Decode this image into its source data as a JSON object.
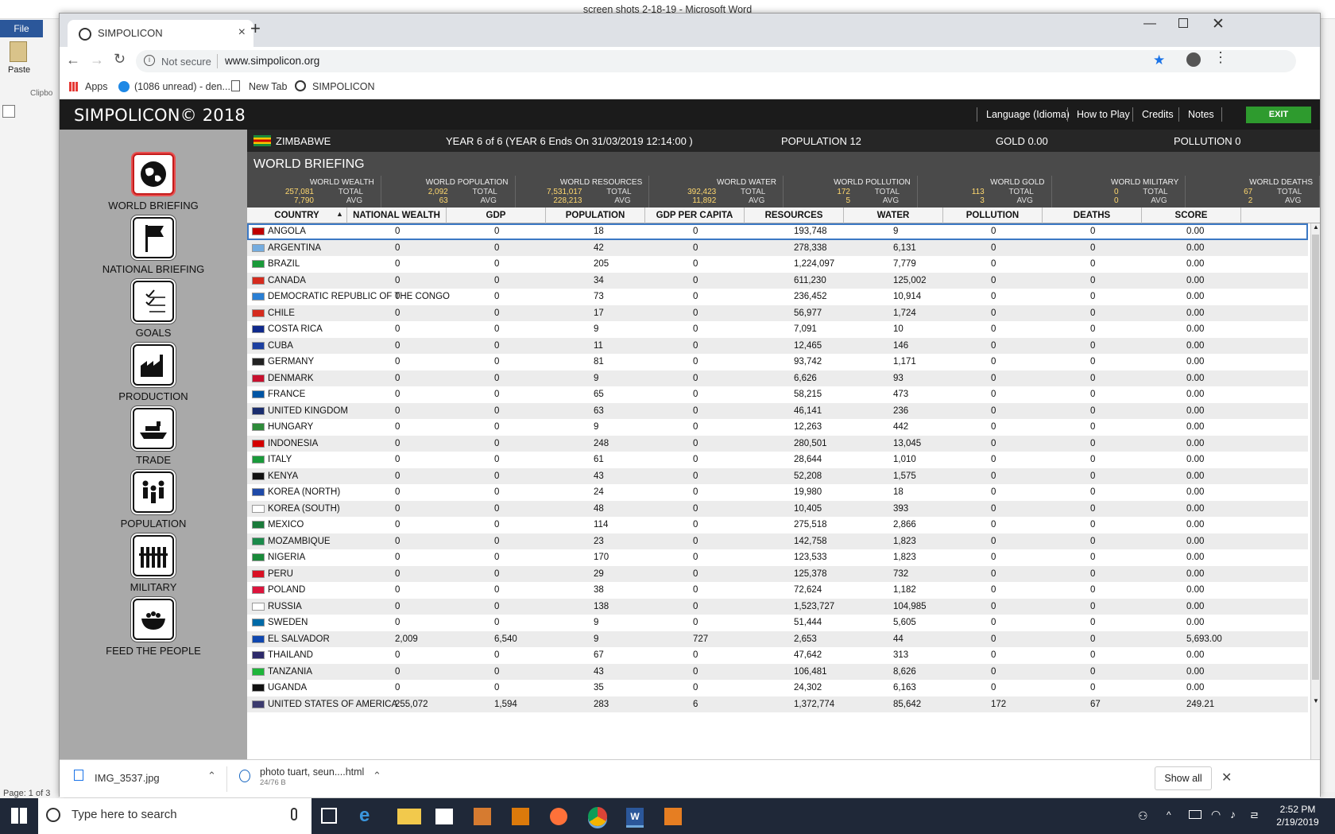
{
  "word": {
    "title": "screen shots 2-18-19  -  Microsoft Word",
    "file_tab": "File",
    "paste": "Paste",
    "clipboard": "Clipbo",
    "page_status": "Page: 1 of 3"
  },
  "browser": {
    "tab_title": "SIMPOLICON",
    "not_secure": "Not secure",
    "url": "www.simpolicon.org",
    "bookmarks": [
      "Apps",
      "(1086 unread) - den...",
      "New Tab",
      "SIMPOLICON"
    ]
  },
  "app": {
    "title": "SIMPOLICON© 2018",
    "menu": [
      "Language (Idioma)",
      "How to Play",
      "Credits",
      "Notes"
    ],
    "exit": "EXIT",
    "nav": [
      "WORLD BRIEFING",
      "NATIONAL BRIEFING",
      "GOALS",
      "PRODUCTION",
      "TRADE",
      "POPULATION",
      "MILITARY",
      "FEED THE PEOPLE"
    ],
    "info": {
      "country": "ZIMBABWE",
      "year": "YEAR  6 of 6  (YEAR 6 Ends On 31/03/2019 12:14:00 )",
      "population": "POPULATION  12",
      "gold": "GOLD  0.00",
      "pollution": "POLLUTION  0"
    },
    "section_title": "WORLD BRIEFING",
    "stats": [
      {
        "name": "WORLD WEALTH",
        "total": "257,081",
        "avg": "7,790"
      },
      {
        "name": "WORLD POPULATION",
        "total": "2,092",
        "avg": "63"
      },
      {
        "name": "WORLD RESOURCES",
        "total": "7,531,017",
        "avg": "228,213"
      },
      {
        "name": "WORLD WATER",
        "total": "392,423",
        "avg": "11,892"
      },
      {
        "name": "WORLD POLLUTION",
        "total": "172",
        "avg": "5"
      },
      {
        "name": "WORLD GOLD",
        "total": "113",
        "avg": "3"
      },
      {
        "name": "WORLD MILITARY",
        "total": "0",
        "avg": "0"
      },
      {
        "name": "WORLD DEATHS",
        "total": "67",
        "avg": "2"
      }
    ],
    "stat_total_label": "TOTAL",
    "stat_avg_label": "AVG",
    "columns": [
      "COUNTRY",
      "NATIONAL WEALTH",
      "GDP",
      "POPULATION",
      "GDP PER CAPITA",
      "RESOURCES",
      "WATER",
      "POLLUTION",
      "DEATHS",
      "SCORE"
    ],
    "sort_indicator": "▲",
    "rows": [
      [
        "ANGOLA",
        "0",
        "0",
        "18",
        "0",
        "193,748",
        "9",
        "0",
        "0",
        "0.00"
      ],
      [
        "ARGENTINA",
        "0",
        "0",
        "42",
        "0",
        "278,338",
        "6,131",
        "0",
        "0",
        "0.00"
      ],
      [
        "BRAZIL",
        "0",
        "0",
        "205",
        "0",
        "1,224,097",
        "7,779",
        "0",
        "0",
        "0.00"
      ],
      [
        "CANADA",
        "0",
        "0",
        "34",
        "0",
        "611,230",
        "125,002",
        "0",
        "0",
        "0.00"
      ],
      [
        "DEMOCRATIC REPUBLIC OF THE CONGO",
        "0",
        "0",
        "73",
        "0",
        "236,452",
        "10,914",
        "0",
        "0",
        "0.00"
      ],
      [
        "CHILE",
        "0",
        "0",
        "17",
        "0",
        "56,977",
        "1,724",
        "0",
        "0",
        "0.00"
      ],
      [
        "COSTA RICA",
        "0",
        "0",
        "9",
        "0",
        "7,091",
        "10",
        "0",
        "0",
        "0.00"
      ],
      [
        "CUBA",
        "0",
        "0",
        "11",
        "0",
        "12,465",
        "146",
        "0",
        "0",
        "0.00"
      ],
      [
        "GERMANY",
        "0",
        "0",
        "81",
        "0",
        "93,742",
        "1,171",
        "0",
        "0",
        "0.00"
      ],
      [
        "DENMARK",
        "0",
        "0",
        "9",
        "0",
        "6,626",
        "93",
        "0",
        "0",
        "0.00"
      ],
      [
        "FRANCE",
        "0",
        "0",
        "65",
        "0",
        "58,215",
        "473",
        "0",
        "0",
        "0.00"
      ],
      [
        "UNITED KINGDOM",
        "0",
        "0",
        "63",
        "0",
        "46,141",
        "236",
        "0",
        "0",
        "0.00"
      ],
      [
        "HUNGARY",
        "0",
        "0",
        "9",
        "0",
        "12,263",
        "442",
        "0",
        "0",
        "0.00"
      ],
      [
        "INDONESIA",
        "0",
        "0",
        "248",
        "0",
        "280,501",
        "13,045",
        "0",
        "0",
        "0.00"
      ],
      [
        "ITALY",
        "0",
        "0",
        "61",
        "0",
        "28,644",
        "1,010",
        "0",
        "0",
        "0.00"
      ],
      [
        "KENYA",
        "0",
        "0",
        "43",
        "0",
        "52,208",
        "1,575",
        "0",
        "0",
        "0.00"
      ],
      [
        "KOREA (NORTH)",
        "0",
        "0",
        "24",
        "0",
        "19,980",
        "18",
        "0",
        "0",
        "0.00"
      ],
      [
        "KOREA (SOUTH)",
        "0",
        "0",
        "48",
        "0",
        "10,405",
        "393",
        "0",
        "0",
        "0.00"
      ],
      [
        "MEXICO",
        "0",
        "0",
        "114",
        "0",
        "275,518",
        "2,866",
        "0",
        "0",
        "0.00"
      ],
      [
        "MOZAMBIQUE",
        "0",
        "0",
        "23",
        "0",
        "142,758",
        "1,823",
        "0",
        "0",
        "0.00"
      ],
      [
        "NIGERIA",
        "0",
        "0",
        "170",
        "0",
        "123,533",
        "1,823",
        "0",
        "0",
        "0.00"
      ],
      [
        "PERU",
        "0",
        "0",
        "29",
        "0",
        "125,378",
        "732",
        "0",
        "0",
        "0.00"
      ],
      [
        "POLAND",
        "0",
        "0",
        "38",
        "0",
        "72,624",
        "1,182",
        "0",
        "0",
        "0.00"
      ],
      [
        "RUSSIA",
        "0",
        "0",
        "138",
        "0",
        "1,523,727",
        "104,985",
        "0",
        "0",
        "0.00"
      ],
      [
        "SWEDEN",
        "0",
        "0",
        "9",
        "0",
        "51,444",
        "5,605",
        "0",
        "0",
        "0.00"
      ],
      [
        "EL SALVADOR",
        "2,009",
        "6,540",
        "9",
        "727",
        "2,653",
        "44",
        "0",
        "0",
        "5,693.00"
      ],
      [
        "THAILAND",
        "0",
        "0",
        "67",
        "0",
        "47,642",
        "313",
        "0",
        "0",
        "0.00"
      ],
      [
        "TANZANIA",
        "0",
        "0",
        "43",
        "0",
        "106,481",
        "8,626",
        "0",
        "0",
        "0.00"
      ],
      [
        "UGANDA",
        "0",
        "0",
        "35",
        "0",
        "24,302",
        "6,163",
        "0",
        "0",
        "0.00"
      ],
      [
        "UNITED STATES OF AMERICA",
        "255,072",
        "1,594",
        "283",
        "6",
        "1,372,774",
        "85,642",
        "172",
        "67",
        "249.21"
      ]
    ],
    "flag_colors": [
      "#c00000",
      "#74acdf",
      "#1a9a3a",
      "#d52b1e",
      "#2a7fd4",
      "#d52b1e",
      "#0f2a8c",
      "#1c3fa0",
      "#222222",
      "#c8102e",
      "#0055a4",
      "#1a2d6e",
      "#2e8b3a",
      "#d40000",
      "#1a9a3a",
      "#111111",
      "#1f4aa8",
      "#ffffff",
      "#1a7a3a",
      "#1a8a4a",
      "#1a8a3a",
      "#d91023",
      "#dc143c",
      "#ffffff",
      "#006aa7",
      "#0f47af",
      "#2d2a6a",
      "#1eb53a",
      "#111111",
      "#3c3b6e"
    ]
  },
  "downloads": {
    "items": [
      {
        "name": "IMG_3537.jpg",
        "sub": ""
      },
      {
        "name": "photo tuart, seun....html",
        "sub": "24/76 B"
      }
    ],
    "show_all": "Show all"
  },
  "taskbar": {
    "search_placeholder": "Type here to search",
    "time": "2:52 PM",
    "date": "2/19/2019"
  }
}
